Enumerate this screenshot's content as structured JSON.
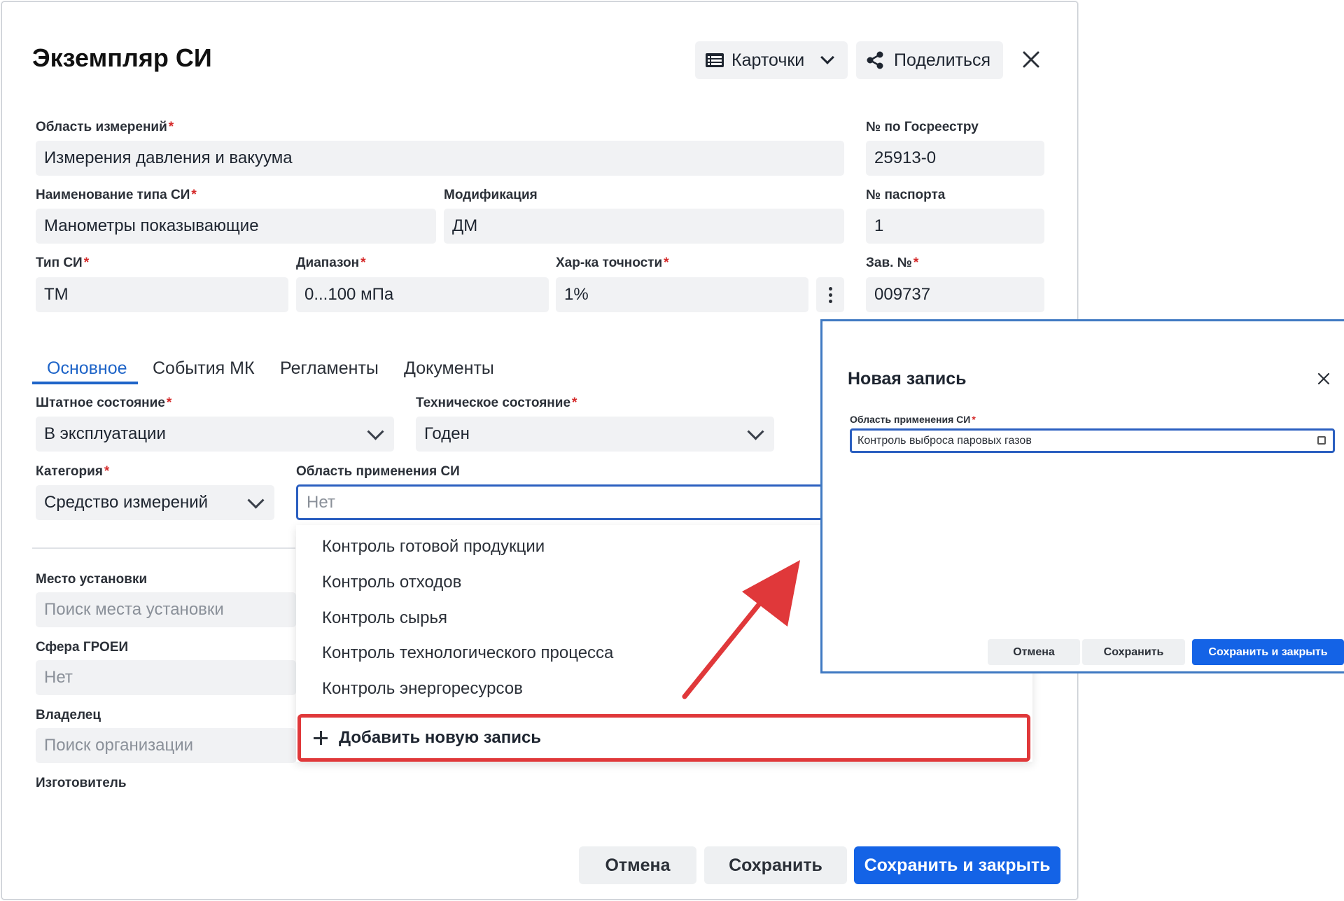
{
  "dialog": {
    "title": "Экземпляр СИ",
    "cards_button": "Карточки",
    "share_button": "Поделиться"
  },
  "fields": {
    "measurement_area": {
      "label": "Область измерений",
      "value": "Измерения давления и вакуума"
    },
    "registry_no": {
      "label": "№ по Госреестру",
      "value": "25913-0"
    },
    "type_name": {
      "label": "Наименование типа СИ",
      "value": "Манометры показывающие"
    },
    "modification": {
      "label": "Модификация",
      "value": "ДМ"
    },
    "passport_no": {
      "label": "№ паспорта",
      "value": "1"
    },
    "si_type": {
      "label": "Тип СИ",
      "value": "ТМ"
    },
    "range": {
      "label": "Диапазон",
      "value": "0...100 мПа"
    },
    "accuracy": {
      "label": "Хар-ка точности",
      "value": "1%"
    },
    "serial_no": {
      "label": "Зав. №",
      "value": "009737"
    }
  },
  "tabs": [
    "Основное",
    "События МК",
    "Регламенты",
    "Документы"
  ],
  "main": {
    "staff_state": {
      "label": "Штатное состояние",
      "value": "В эксплуатации"
    },
    "tech_state": {
      "label": "Техническое состояние",
      "value": "Годен"
    },
    "category": {
      "label": "Категория",
      "value": "Средство измерений"
    },
    "application_area": {
      "label": "Область применения СИ",
      "placeholder": "Нет"
    },
    "install_place": {
      "label": "Место установки",
      "placeholder": "Поиск места установки"
    },
    "groei": {
      "label": "Сфера ГРОЕИ",
      "placeholder": "Нет"
    },
    "owner": {
      "label": "Владелец",
      "placeholder": "Поиск организации"
    },
    "manufacturer": {
      "label": "Изготовитель"
    }
  },
  "dropdown": {
    "items": [
      "Контроль готовой продукции",
      "Контроль отходов",
      "Контроль сырья",
      "Контроль технологического процесса",
      "Контроль энергоресурсов"
    ],
    "add_new": "Добавить новую запись"
  },
  "footer": {
    "cancel": "Отмена",
    "save": "Сохранить",
    "save_close": "Сохранить и закрыть"
  },
  "new_record": {
    "title": "Новая запись",
    "field_label": "Область применения СИ",
    "field_value": "Контроль выброса паровых газов",
    "cancel": "Отмена",
    "save": "Сохранить",
    "save_close": "Сохранить и закрыть"
  },
  "colors": {
    "accent": "#1463e6",
    "highlight": "#e0383a",
    "overlay_border": "#3f79c2"
  }
}
